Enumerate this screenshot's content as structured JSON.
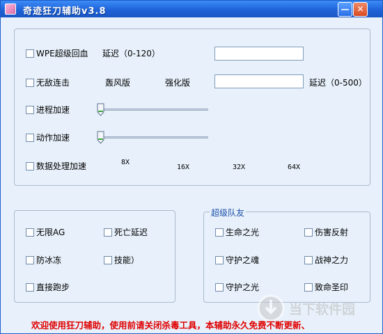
{
  "window": {
    "title": "奇迹狂刀辅助v3.8",
    "min_glyph": "—",
    "close_glyph": "✕"
  },
  "main": {
    "wpe_label": "WPE超级回血",
    "wpe_delay_label": "延迟（0-120）",
    "wpe_delay_value": "",
    "invincible_label": "无敌连击",
    "whirlwind_label": "轰风版",
    "enhanced_label": "强化版",
    "invincible_delay_value": "",
    "invincible_delay_label": "延迟（0-500）",
    "process_speed_label": "进程加速",
    "action_speed_label": "动作加速",
    "data_speed_label": "数据处理加速",
    "speed_ticks": [
      "8X",
      "16X",
      "32X",
      "64X"
    ],
    "process_speed_level": 0,
    "action_speed_level": 0
  },
  "left_group": {
    "items": [
      {
        "label": "无限AG"
      },
      {
        "label": "死亡延迟"
      },
      {
        "label": "防冰冻"
      },
      {
        "label": "技能）"
      },
      {
        "label": "直接跑步"
      }
    ]
  },
  "right_group": {
    "title": "超级队友",
    "items": [
      {
        "label": "生命之光"
      },
      {
        "label": "伤害反射"
      },
      {
        "label": "守护之魂"
      },
      {
        "label": "战神之力"
      },
      {
        "label": "守护之光"
      },
      {
        "label": "致命圣印"
      }
    ]
  },
  "footer": {
    "notice": "欢迎使用狂刀辅助，使用前请关闭杀毒工具，本辅助永久免费不断更新、"
  },
  "watermark": {
    "text": "当下软件园"
  },
  "colors": {
    "title_bar": "#1e63d8",
    "window_bg": "#e8f1fb",
    "footer_text": "#e00000",
    "group_title": "#1c4fa8"
  }
}
